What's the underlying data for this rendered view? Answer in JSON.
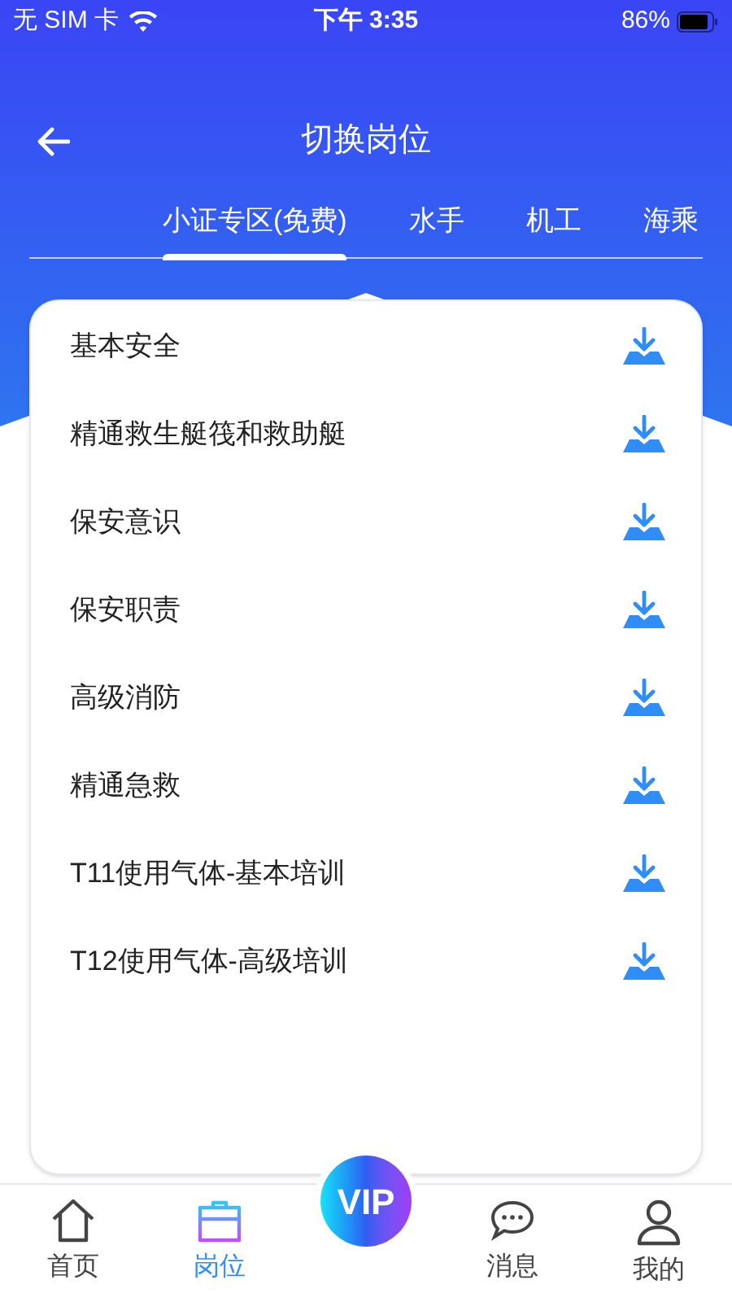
{
  "status_bar": {
    "carrier": "无 SIM 卡",
    "time": "下午 3:35",
    "battery": "86%"
  },
  "header": {
    "title": "切换岗位"
  },
  "tabs": [
    {
      "label": "小证专区(免费)",
      "selected": true
    },
    {
      "label": "水手",
      "selected": false
    },
    {
      "label": "机工",
      "selected": false
    },
    {
      "label": "海乘",
      "selected": false
    }
  ],
  "courses": [
    {
      "name": "基本安全"
    },
    {
      "name": "精通救生艇筏和救助艇"
    },
    {
      "name": "保安意识"
    },
    {
      "name": "保安职责"
    },
    {
      "name": "高级消防"
    },
    {
      "name": "精通急救"
    },
    {
      "name": "T11使用气体-基本培训"
    },
    {
      "name": "T12使用气体-高级培训"
    }
  ],
  "tab_bar": [
    {
      "kind": "home",
      "label": "首页",
      "selected": false
    },
    {
      "kind": "job",
      "label": "岗位",
      "selected": true
    },
    {
      "kind": "vip",
      "label": "VIP"
    },
    {
      "kind": "message",
      "label": "消息",
      "selected": false
    },
    {
      "kind": "me",
      "label": "我的",
      "selected": false
    }
  ]
}
